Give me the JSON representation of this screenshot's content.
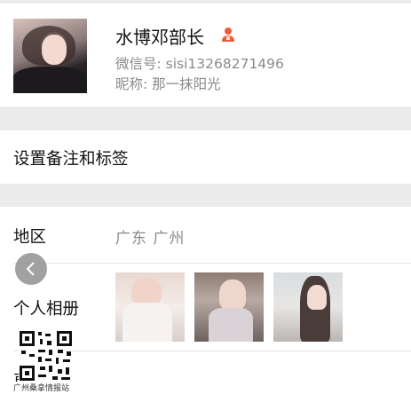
{
  "profile": {
    "name": "水博邓部长",
    "wechat_id": "微信号: sisi13268271496",
    "nickname": "昵称: 那一抹阳光",
    "badge_color": "#f05a3c"
  },
  "remark": {
    "label": "设置备注和标签"
  },
  "details": {
    "region_label": "地区",
    "region_value": "广东  广州",
    "album_label": "个人相册",
    "more_label_partial": "更"
  },
  "overlay": {
    "back_icon": "chevron-left-icon",
    "qr_caption": "广州桑拿情报站"
  },
  "colors": {
    "background": "#ebebeb",
    "secondary_text": "#8a8a8a",
    "divider": "#e2e2e2"
  }
}
